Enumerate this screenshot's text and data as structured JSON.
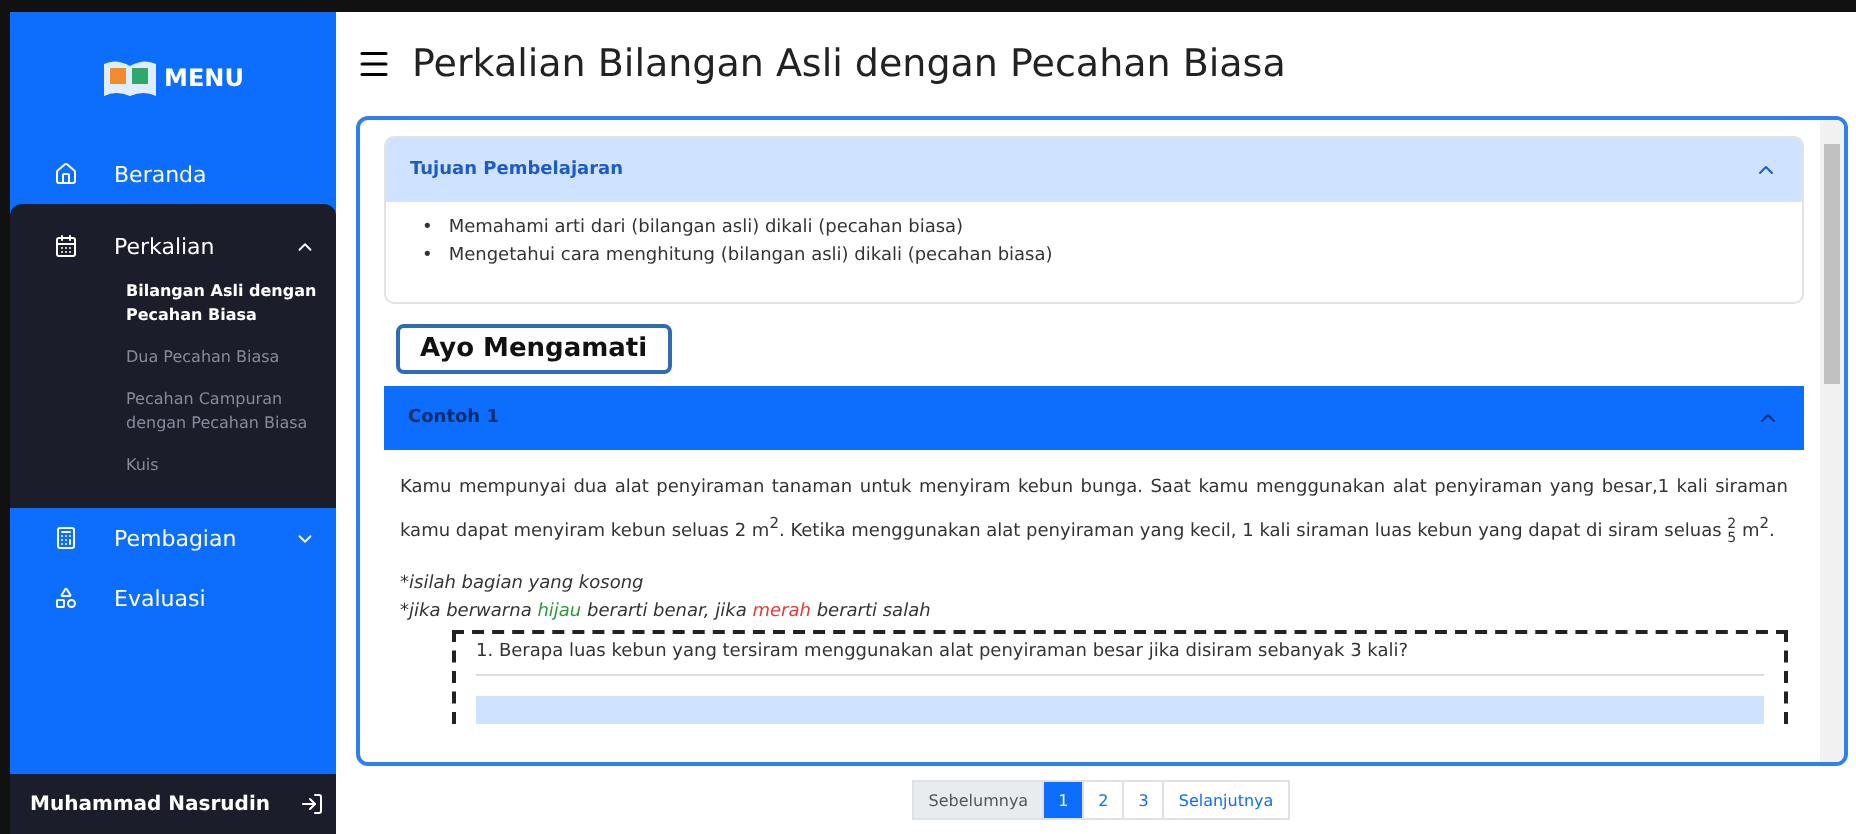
{
  "sidebar": {
    "logo_text": "MENU",
    "items": [
      {
        "label": "Beranda",
        "expandable": false,
        "expanded": false
      },
      {
        "label": "Perkalian",
        "expandable": true,
        "expanded": true,
        "children": [
          {
            "label": "Bilangan Asli dengan Pecahan Biasa",
            "selected": true
          },
          {
            "label": "Dua Pecahan Biasa",
            "selected": false
          },
          {
            "label": "Pecahan Campuran dengan Pecahan Biasa",
            "selected": false
          },
          {
            "label": "Kuis",
            "selected": false
          }
        ]
      },
      {
        "label": "Pembagian",
        "expandable": true,
        "expanded": false
      },
      {
        "label": "Evaluasi",
        "expandable": false,
        "expanded": false
      }
    ],
    "user": "Muhammad Nasrudin"
  },
  "title": "Perkalian Bilangan Asli dengan Pecahan Biasa",
  "objectives": {
    "title": "Tujuan Pembelajaran",
    "expanded": true,
    "marker": "•",
    "items": [
      "Memahami arti dari (bilangan asli) dikali (pecahan biasa)",
      "Mengetahui cara menghitung (bilangan asli) dikali (pecahan biasa)"
    ]
  },
  "banner": "Ayo Mengamati",
  "example": {
    "title": "Contoh 1",
    "expanded": true,
    "paragraph": [
      {
        "kind": "text",
        "text": "Kamu mempunyai dua alat penyiraman tanaman untuk menyiram kebun bunga. Saat kamu menggunakan alat penyiraman yang besar,1 kali siraman kamu dapat menyiram kebun seluas 2 m$^{2}$. Ketika menggunakan alat penyiraman yang kecil, 1 kali siraman luas kebun yang dapat di siram seluas "
      },
      {
        "kind": "fraction",
        "num": "2",
        "den": "5"
      },
      {
        "kind": "text",
        "text": " m$^{2}$."
      }
    ],
    "note_1": "*isilah bagian yang kosong",
    "note_2": [
      {
        "kind": "plain",
        "text": "*jika berwarna "
      },
      {
        "kind": "correct",
        "text": "hijau"
      },
      {
        "kind": "plain",
        "text": " berarti benar, jika "
      },
      {
        "kind": "wrong",
        "text": "merah"
      },
      {
        "kind": "plain",
        "text": " berarti salah"
      }
    ],
    "question": "1. Berapa luas kebun yang tersiram menggunakan alat penyiraman besar jika disiram sebanyak 3 kali?"
  },
  "pagination": {
    "previous": "Sebelumnya",
    "pages": [
      {
        "label": "1",
        "selected": true
      },
      {
        "label": "2",
        "selected": false
      },
      {
        "label": "3",
        "selected": false
      }
    ],
    "next": "Selanjutnya"
  }
}
